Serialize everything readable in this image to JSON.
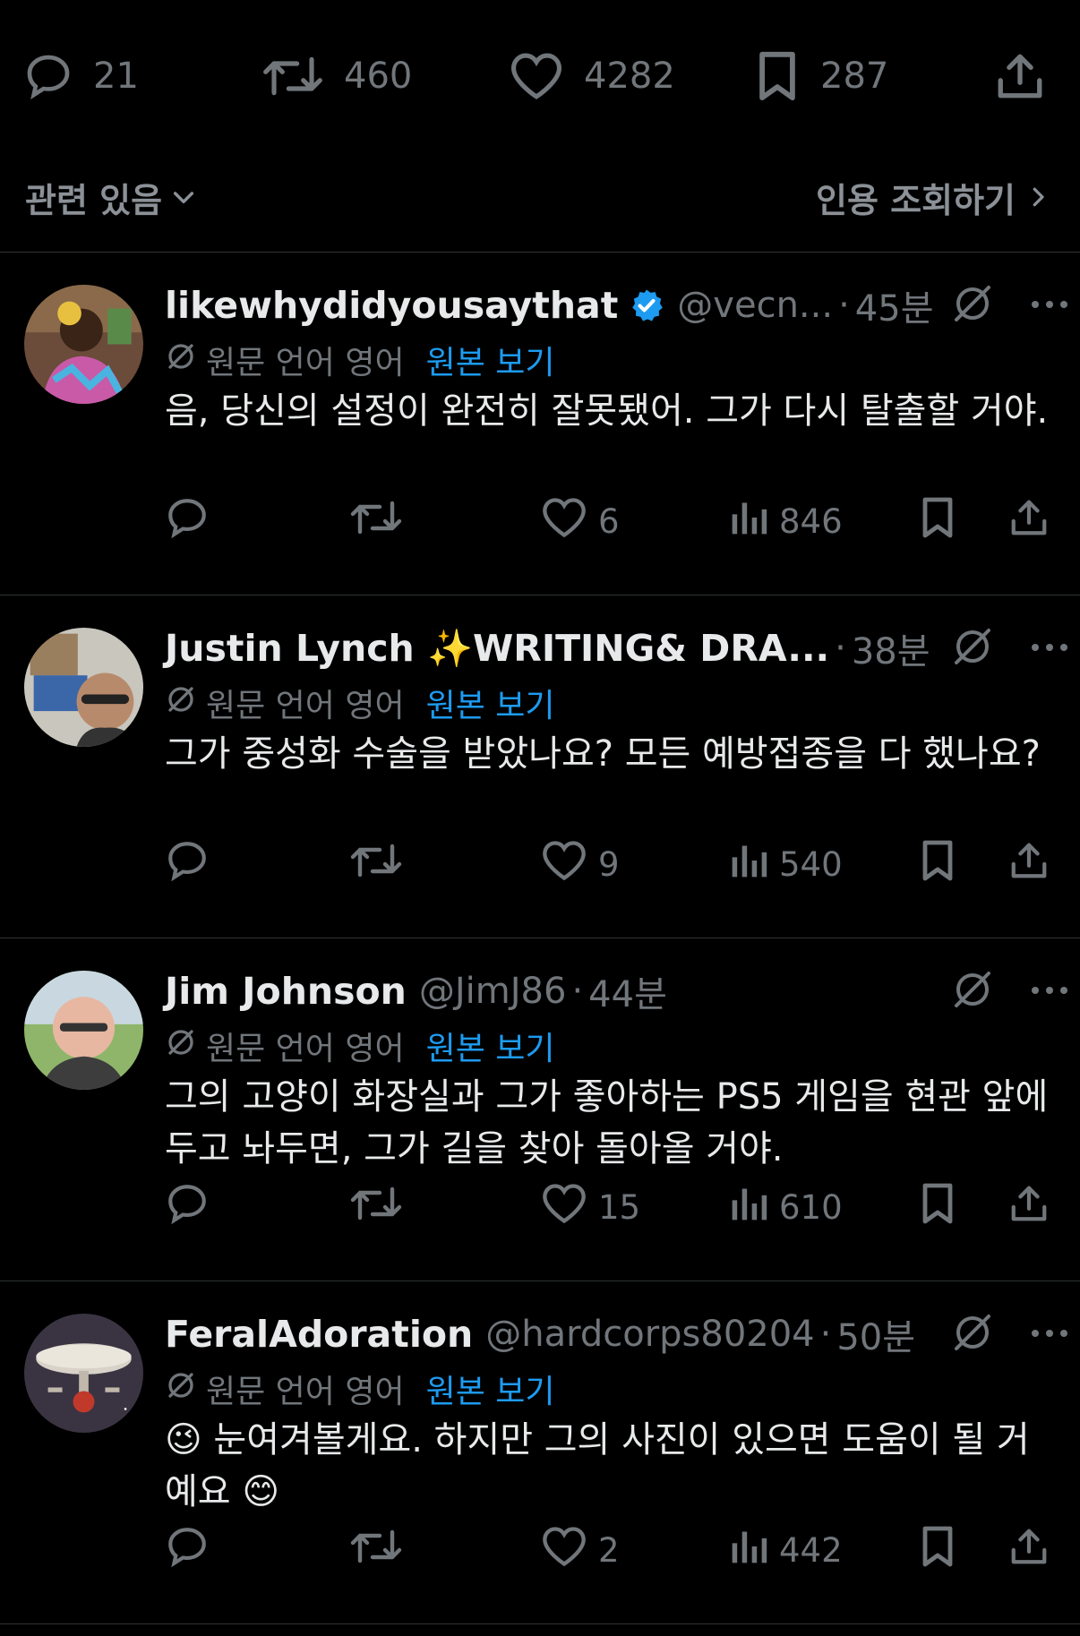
{
  "tweet_stats": {
    "replies": "21",
    "retweets": "460",
    "likes": "4282",
    "bookmarks": "287"
  },
  "related": {
    "left_label": "관련 있음",
    "right_label": "인용 조회하기"
  },
  "replies": [
    {
      "name": "likewhydidyousaythat",
      "verified": true,
      "handle": "@vecn...",
      "time": "45분",
      "translate_label": "원문 언어 영어",
      "translate_link": "원본 보기",
      "text": "음, 당신의 설정이 완전히 잘못됐어. 그가 다시 탈출할 거야.",
      "likes": "6",
      "views": "846"
    },
    {
      "name": "Justin Lynch ✨WRITING& DRA...",
      "verified": false,
      "handle": "",
      "time": "38분",
      "translate_label": "원문 언어 영어",
      "translate_link": "원본 보기",
      "text": "그가 중성화 수술을 받았나요? 모든 예방접종을 다 했나요?",
      "likes": "9",
      "views": "540"
    },
    {
      "name": "Jim Johnson",
      "verified": false,
      "handle": "@JimJ86",
      "time": "44분",
      "translate_label": "원문 언어 영어",
      "translate_link": "원본 보기",
      "text": "그의 고양이 화장실과 그가 좋아하는 PS5 게임을 현관 앞에 두고 놔두면, 그가 길을 찾아 돌아올 거야.",
      "likes": "15",
      "views": "610"
    },
    {
      "name": "FeralAdoration",
      "verified": false,
      "handle": "@hardcorps80204",
      "time": "50분",
      "translate_label": "원문 언어 영어",
      "translate_link": "원본 보기",
      "text": "😉 눈여겨볼게요. 하지만 그의 사진이 있으면 도움이 될 거예요 😊",
      "likes": "2",
      "views": "442"
    }
  ],
  "colors": {
    "background": "#000000",
    "text_primary": "#e7e9ea",
    "text_secondary": "#71767b",
    "link": "#1d9bf0",
    "divider": "#2f3336"
  }
}
